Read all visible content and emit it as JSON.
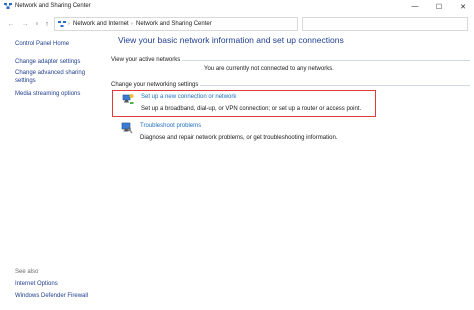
{
  "window": {
    "title": "Network and Sharing Center",
    "minimize_glyph": "—",
    "maximize_glyph": "☐",
    "close_glyph": "✕"
  },
  "address_bar": {
    "back_glyph": "←",
    "forward_glyph": "→",
    "recent_glyph": "∨",
    "up_glyph": "↑",
    "separator": "›",
    "segments": [
      "Network and Internet",
      "Network and Sharing Center"
    ],
    "dropdown_glyph": "∨",
    "refresh_glyph": "↻",
    "search_placeholder": ""
  },
  "sidebar": {
    "items": [
      "Control Panel Home",
      "Change adapter settings",
      "Change advanced sharing settings",
      "Media streaming options"
    ],
    "see_also_label": "See also",
    "see_also_items": [
      "Internet Options",
      "Windows Defender Firewall"
    ]
  },
  "main": {
    "title": "View your basic network information and set up connections",
    "active_networks_label": "View your active networks",
    "status_text": "You are currently not connected to any networks.",
    "settings_label": "Change your networking settings",
    "tasks": [
      {
        "link": "Set up a new connection or network",
        "description": "Set up a broadband, dial-up, or VPN connection; or set up a router or access point.",
        "icon": "new-connection-icon"
      },
      {
        "link": "Troubleshoot problems",
        "description": "Diagnose and repair network problems, or get troubleshooting information.",
        "icon": "troubleshoot-icon"
      }
    ]
  },
  "colors": {
    "link": "#1f6fbf",
    "heading": "#1f3f8f",
    "highlight": "#e03a3a"
  }
}
